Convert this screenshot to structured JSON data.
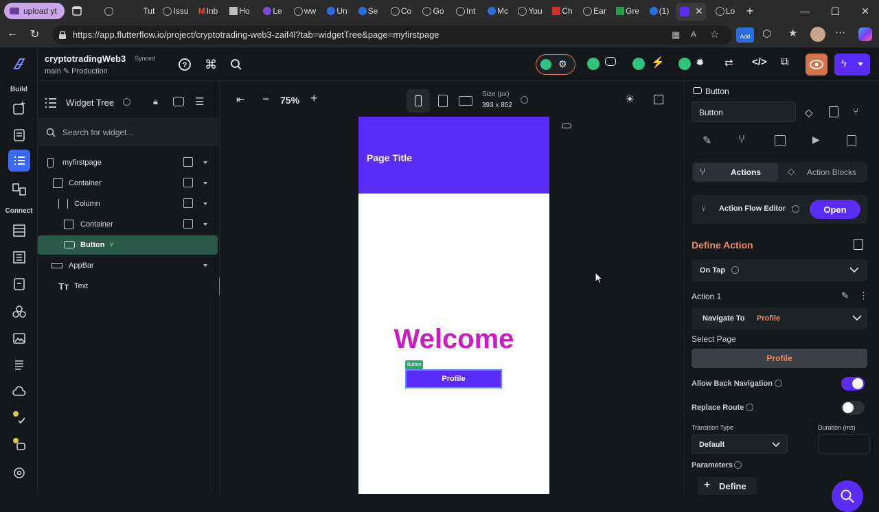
{
  "browser": {
    "upload_tab": "upload yt",
    "tabs": [
      "Tut",
      "Issu",
      "Inb",
      "Ho",
      "Le",
      "ww",
      "Un",
      "Se",
      "Co",
      "Go",
      "Int",
      "Mc",
      "You",
      "Ch",
      "Ear",
      "Gre",
      "(1)",
      "",
      "Lo"
    ],
    "url": "https://app.flutterflow.io/project/cryptotrading-web3-zaif4l?tab=widgetTree&page=myfirstpage",
    "ext_badge": "Add"
  },
  "app": {
    "project_name": "cryptotradingWeb3",
    "sync_status": "Synced",
    "branch": "main ✎ Production"
  },
  "rail": {
    "build_label": "Build",
    "connect_label": "Connect"
  },
  "widget_tree": {
    "title": "Widget Tree",
    "search_placeholder": "Search for widget...",
    "nodes": [
      "myfirstpage",
      "Container",
      "Column",
      "Container",
      "Button",
      "AppBar",
      "Text"
    ]
  },
  "canvas": {
    "zoom": "75%",
    "size_label": "Size (px)",
    "size_value": "393 x 852",
    "page_title": "Page Title",
    "welcome": "Welcome",
    "button_badge": "Button",
    "button_label": "Profile"
  },
  "props": {
    "widget_type": "Button",
    "widget_name": "Button",
    "tab_actions": "Actions",
    "tab_action_blocks": "Action Blocks",
    "action_flow_editor": "Action Flow Editor",
    "open": "Open",
    "define_action": "Define Action",
    "trigger": "On Tap",
    "action1": "Action 1",
    "nav_to": "Navigate To",
    "nav_target": "Profile",
    "select_page": "Select Page",
    "selected_page": "Profile",
    "allow_back": "Allow Back Navigation",
    "allow_back_on": true,
    "replace_route": "Replace Route",
    "replace_route_on": false,
    "transition_type": "Transition Type",
    "transition_value": "Default",
    "duration": "Duration (ms)",
    "parameters": "Parameters",
    "define": "Define"
  },
  "colors": {
    "accent": "#5a2cf6",
    "welcome": "#c81ec1",
    "orange": "#ee8b60",
    "selected_row": "#2a5a47"
  }
}
